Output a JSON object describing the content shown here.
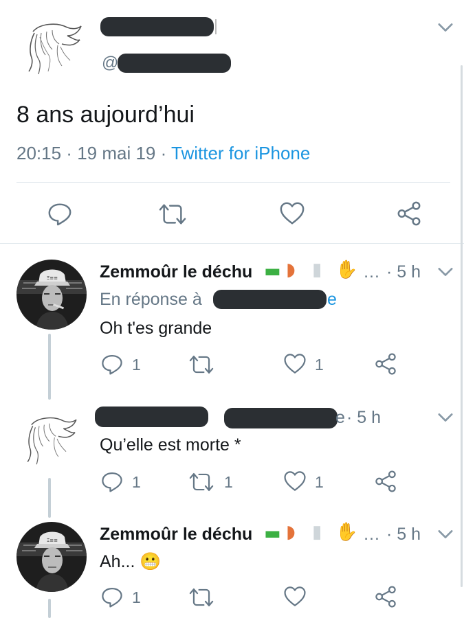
{
  "main_tweet": {
    "at_prefix": "@",
    "text": "8 ans aujourd’hui",
    "time": "20:15",
    "dot1": " · ",
    "date": "19 mai 19",
    "dot2": " · ",
    "source": "Twitter for iPhone"
  },
  "replies": [
    {
      "name": "Zemmoûr le déchu",
      "ellipsis": "…",
      "time": "· 5 h",
      "in_reply_label": "En réponse à",
      "in_reply_tail": "e",
      "text": "Oh t'es grande",
      "reply_count": "1",
      "retweet_count": "",
      "like_count": "1"
    },
    {
      "time_prefix": "e",
      "time": "· 5 h",
      "text": "Qu’elle est morte *",
      "reply_count": "1",
      "retweet_count": "1",
      "like_count": "1"
    },
    {
      "name": "Zemmoûr le déchu",
      "ellipsis": "…",
      "time": "· 5 h",
      "text": "Ah... 😬",
      "reply_count": "1",
      "retweet_count": "",
      "like_count": ""
    }
  ],
  "icons": {
    "reply": "speech-bubble-icon",
    "retweet": "retweet-arrows-icon",
    "like": "heart-icon",
    "share": "share-nodes-icon",
    "more": "chevron-down-icon"
  },
  "colors": {
    "link": "#1b95e0",
    "secondary": "#657786",
    "redaction": "#2b2f33"
  }
}
